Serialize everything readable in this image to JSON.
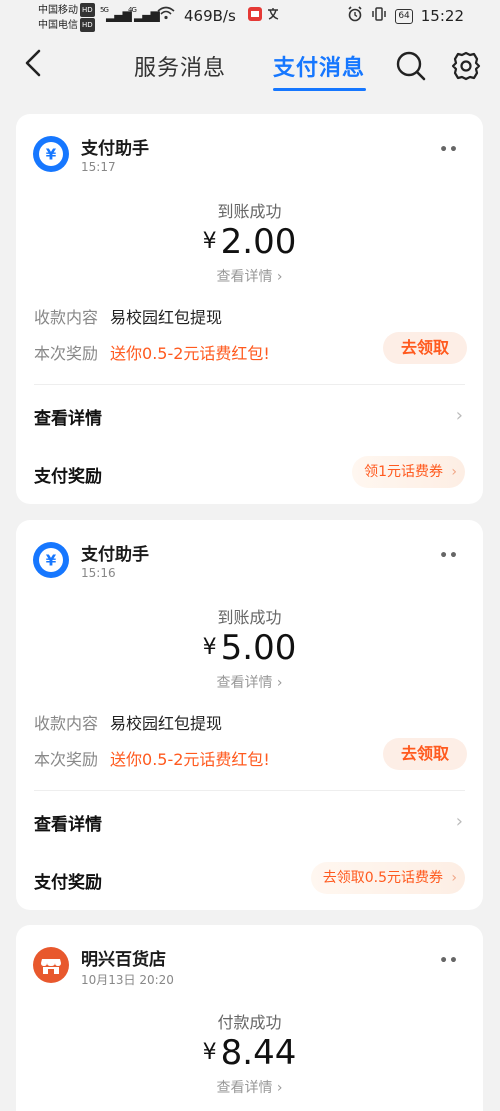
{
  "status_bar": {
    "carrier1": "中国移动",
    "carrier2": "中国电信",
    "hd": "HD",
    "net1": "5G",
    "net2": "4G",
    "speed": "469B/s",
    "battery": "64",
    "time": "15:22"
  },
  "nav": {
    "tab_service": "服务消息",
    "tab_pay": "支付消息"
  },
  "cards": [
    {
      "sender": "支付助手",
      "time": "15:17",
      "more": "••",
      "status": "到账成功",
      "currency": "¥",
      "amount": "2.00",
      "detail_link": "查看详情",
      "row1_label": "收款内容",
      "row1_value": "易校园红包提现",
      "row2_label": "本次奖励",
      "row2_value": "送你0.5-2元话费红包!",
      "claim_button": "去领取",
      "link1": "查看详情",
      "link2": "支付奖励",
      "coupon": "领1元话费券"
    },
    {
      "sender": "支付助手",
      "time": "15:16",
      "more": "••",
      "status": "到账成功",
      "currency": "¥",
      "amount": "5.00",
      "detail_link": "查看详情",
      "row1_label": "收款内容",
      "row1_value": "易校园红包提现",
      "row2_label": "本次奖励",
      "row2_value": "送你0.5-2元话费红包!",
      "claim_button": "去领取",
      "link1": "查看详情",
      "link2": "支付奖励",
      "coupon": "去领取0.5元话费券"
    },
    {
      "sender": "明兴百货店",
      "time": "10月13日 20:20",
      "more": "••",
      "status": "付款成功",
      "currency": "¥",
      "amount": "8.44",
      "detail_link": "查看详情"
    }
  ],
  "colors": {
    "accent": "#1677ff",
    "promo": "#ff5a1f",
    "merchant": "#e8582d"
  }
}
